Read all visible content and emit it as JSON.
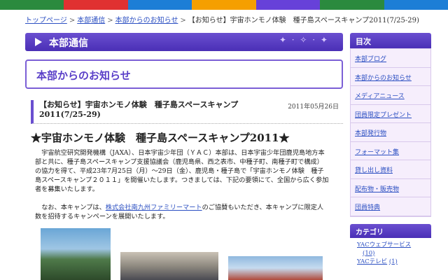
{
  "top_strip_colors": [
    "#2b8a3e",
    "#e03131",
    "#1c7ed6",
    "#f59f00",
    "#6741d9",
    "#2b8a3e",
    "#1c7ed6"
  ],
  "breadcrumb": {
    "items": [
      "トップページ",
      "本部通信",
      "本部からのお知らせ"
    ],
    "current": "【お知らせ】宇宙ホンモノ体験　種子島スペースキャンプ2011(7/25-29)",
    "separator": ">"
  },
  "section_bar": {
    "title": "本部通信"
  },
  "page_title": "本部からのお知らせ",
  "article": {
    "title": "【お知らせ】宇宙ホンモノ体験　種子島スペースキャンプ2011(7/25-29)",
    "date": "2011年05月26日",
    "heading": "★宇宙ホンモノ体験　種子島スペースキャンプ2011★",
    "p1": "宇宙航空研究開発機構（JAXA）、日本宇宙少年団（ＹＡＣ）本部は、日本宇宙少年団鹿児島地方本部と共に、種子島スペースキャンプ支援協議会（鹿児島県、西之表市、中種子町、南種子町で構成）の協力を得て、平成23年7月25日（月）～29日（金）、鹿児島・種子島で「宇宙ホンモノ体験　種子島スペースキャンプ２０１１」を開催いたします。つきましては、下記の要領にて、全国から広く参加者を募集いたします。",
    "p2_before": "なお、本キャンプは、",
    "p2_link": "株式会社南九州ファミリーマート",
    "p2_after": "のご協賛もいただき、本キャンプに限定人数を招待するキャンペーンを展開いたします。"
  },
  "sidebar": {
    "header": "目次",
    "items": [
      "本部ブログ",
      "本部からのお知らせ",
      "メディアニュース",
      "団員限定プレゼント",
      "本部発行物",
      "フォーマット集",
      "貸し出し資料",
      "配布物・販売物",
      "団員特典"
    ],
    "category_header": "カテゴリ",
    "categories": [
      {
        "name": "YACウェブサービス",
        "count": "(10)"
      },
      {
        "name": "YACテレビ",
        "count": "(1)"
      }
    ]
  }
}
